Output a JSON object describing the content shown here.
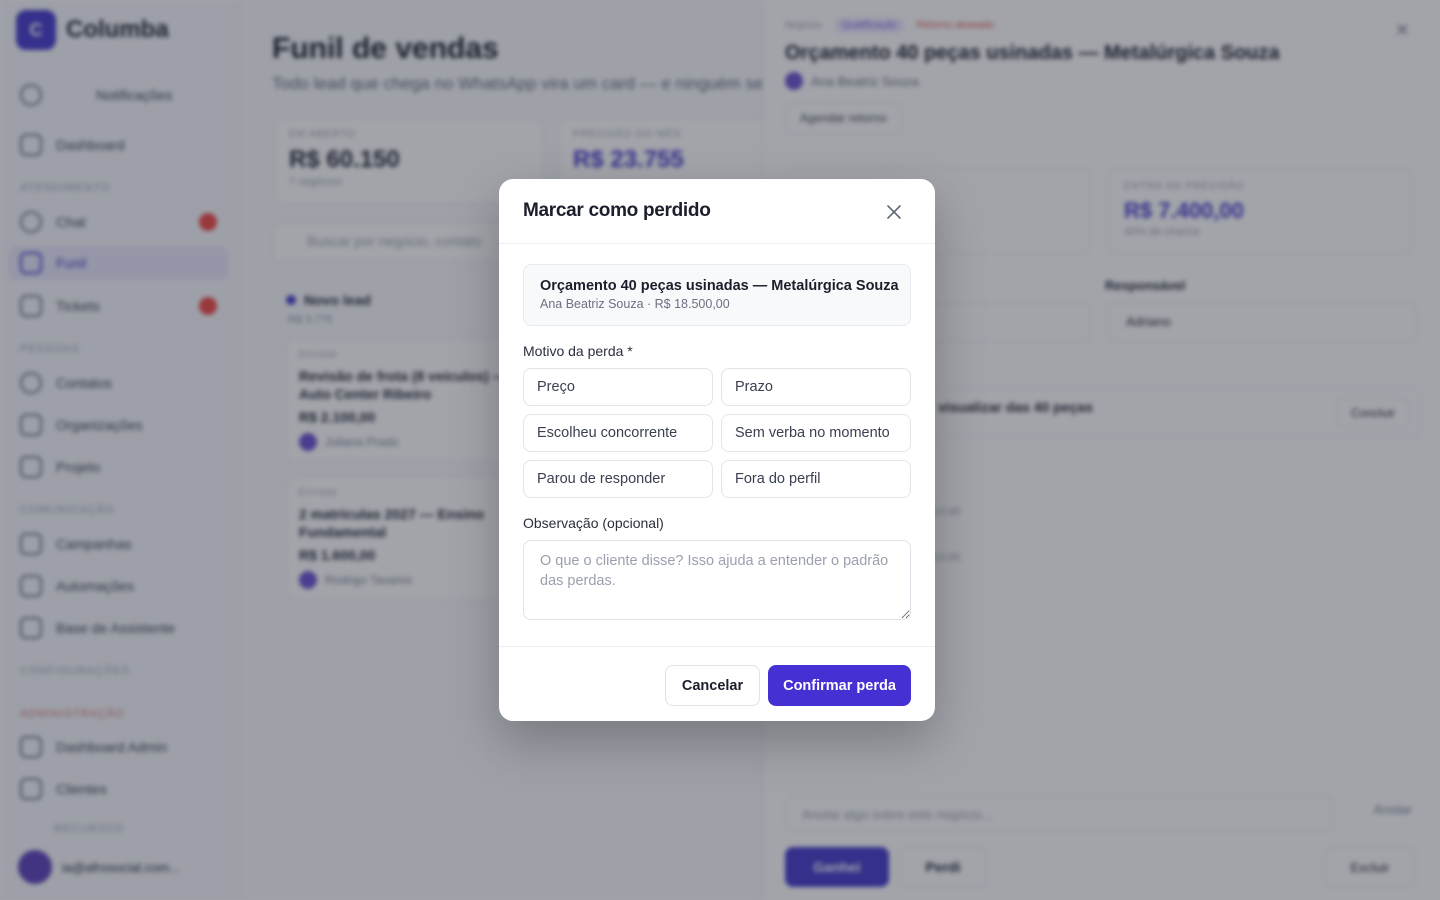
{
  "app": {
    "brand": "Columba",
    "brand_initial": "C"
  },
  "sidebar": {
    "notifications": "Notificações",
    "items": [
      {
        "label": "Dashboard"
      },
      {
        "label": "Chat"
      },
      {
        "label": "Funil"
      },
      {
        "label": "Tickets"
      },
      {
        "label": "Contatos"
      },
      {
        "label": "Organizações"
      },
      {
        "label": "Projeto"
      },
      {
        "label": "Campanhas"
      },
      {
        "label": "Automações"
      },
      {
        "label": "Base de Assistente"
      },
      {
        "label": "Dashboard Admin"
      },
      {
        "label": "Clientes"
      }
    ],
    "sections": [
      "Atendimento",
      "Pessoas",
      "Comunicação",
      "Configurações",
      "Administração",
      "Recursos"
    ],
    "user_email": "ia@afrosocial.com..."
  },
  "page": {
    "title": "Funil de vendas",
    "subtitle": "Todo lead que chega no WhatsApp vira um card — e ninguém se",
    "stats": [
      {
        "label": "Em aberto",
        "value": "R$ 60.150",
        "sub": "7 negócios"
      },
      {
        "label": "Previsão do mês",
        "value": "R$ 23.755",
        "sub": ""
      }
    ],
    "search_placeholder": "Buscar por negócio, contato",
    "column": {
      "name": "Novo lead",
      "sum": "R$ 3.775"
    },
    "cards": [
      {
        "tag": "Entrada",
        "title": "Revisão de frota (8 veículos) — Auto Center Ribeiro",
        "amount": "R$ 2.100,00",
        "owner": "Juliana Prado"
      },
      {
        "tag": "Entrada",
        "title": "2 matrículas 2027 — Ensino Fundamental",
        "amount": "R$ 1.600,00",
        "owner": "Rodrigo Tavares"
      }
    ]
  },
  "drawer": {
    "crumb": "Negócio",
    "stage_pill": "Qualificação",
    "warning": "Retorno atrasado",
    "title": "Orçamento 40 peças usinadas — Metalúrgica Souza",
    "owner": "Ana Beatriz Souza",
    "schedule_button": "Agendar retorno",
    "forecast_label": "Entra na previsão",
    "forecast_value": "R$ 7.400,00",
    "forecast_sub": "40% de chance",
    "responsible_label": "Responsável",
    "responsible_value": "Adriano",
    "task_text": "visualizar das 40 peças",
    "conclude_button": "Concluir",
    "log_time_1": "10:45",
    "log_time_2": "10:45",
    "note_placeholder": "Anotar algo sobre este negócio...",
    "send_button": "Anotar",
    "won_button": "Ganhei",
    "lost_button": "Perdi",
    "delete_button": "Excluir"
  },
  "modal": {
    "title": "Marcar como perdido",
    "deal_title": "Orçamento 40 peças usinadas — Metalúrgica Souza",
    "deal_meta": "Ana Beatriz Souza · R$ 18.500,00",
    "reason_label": "Motivo da perda *",
    "reasons": [
      "Preço",
      "Prazo",
      "Escolheu concorrente",
      "Sem verba no momento",
      "Parou de responder",
      "Fora do perfil"
    ],
    "notes_label": "Observação (opcional)",
    "notes_placeholder": "O que o cliente disse? Isso ajuda a entender o padrão das perdas.",
    "notes_value": "",
    "cancel": "Cancelar",
    "confirm": "Confirmar perda"
  },
  "colors": {
    "accent": "#4530d4",
    "overlay": "rgba(34,38,52,0.42)",
    "danger": "#ef4444"
  }
}
